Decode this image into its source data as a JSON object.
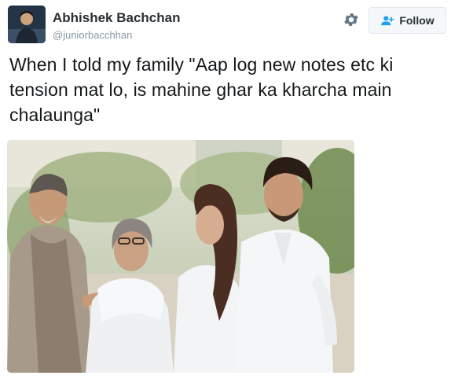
{
  "user": {
    "display_name": "Abhishek Bachchan",
    "handle": "@juniorbacchhan",
    "avatar_icon": "profile-photo"
  },
  "actions": {
    "settings_icon": "gear-icon",
    "follow_label": "Follow",
    "follow_icon": "add-user-icon"
  },
  "tweet": {
    "text": "When I told my family \"Aap log new notes etc ki tension mat lo, is mahine ghar ka kharcha main chalaunga\"",
    "media_description_icon": "family-photo"
  },
  "colors": {
    "name": "#292f33",
    "handle": "#8899a6",
    "button_border": "#e1e8ed",
    "button_bg": "#f5f8fa",
    "follow_icon": "#1da1f2"
  }
}
